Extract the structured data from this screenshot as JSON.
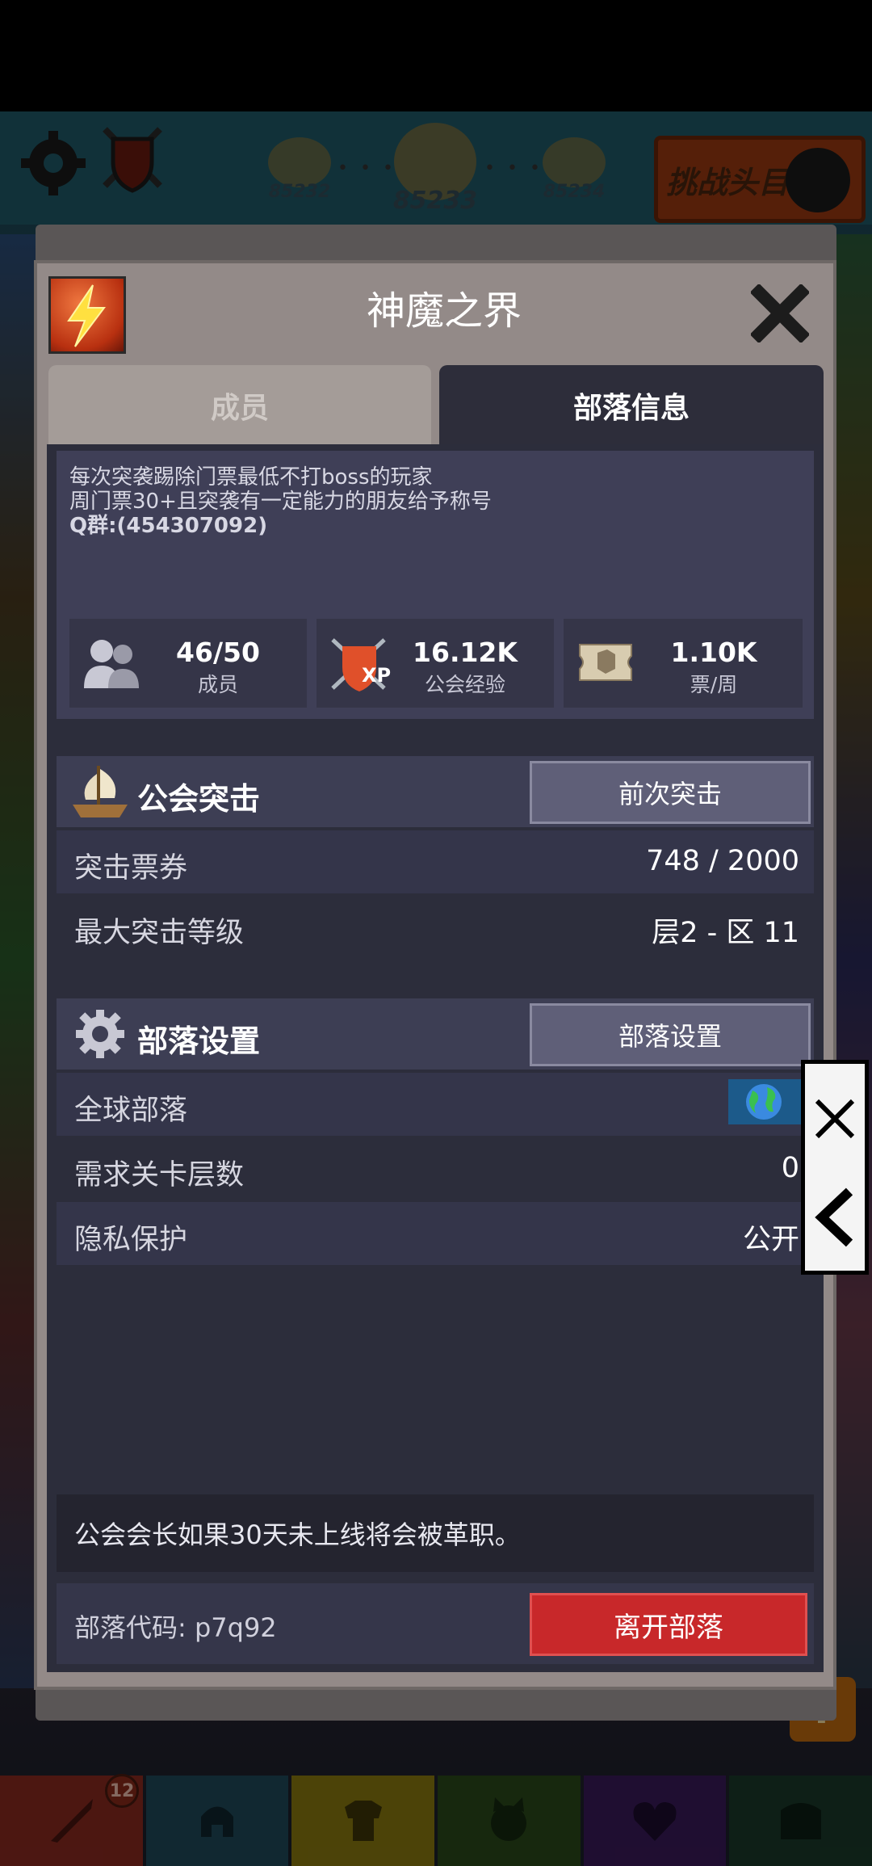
{
  "hud": {
    "stages": [
      "85232",
      "85233",
      "85234"
    ],
    "challenge_button": "挑战头目"
  },
  "dialog": {
    "title": "神魔之界",
    "tabs": {
      "members": "成员",
      "tribe_info": "部落信息"
    },
    "description": [
      "每次突袭踢除门票最低不打boss的玩家",
      "周门票30+且突袭有一定能力的朋友给予称号",
      "Q群:(454307092)"
    ],
    "stats": [
      {
        "value": "46/50",
        "label": "成员",
        "icon": "members-icon"
      },
      {
        "value": "16.12K",
        "label": "公会经验",
        "icon": "xp-shield-icon"
      },
      {
        "value": "1.10K",
        "label": "票/周",
        "icon": "ticket-icon"
      }
    ],
    "raid": {
      "title": "公会突击",
      "button": "前次突击",
      "rows": [
        {
          "label": "突击票券",
          "value": "748 / 2000"
        },
        {
          "label": "最大突击等级",
          "value": "层2 - 区 11"
        }
      ]
    },
    "settings": {
      "title": "部落设置",
      "button": "部落设置",
      "rows": [
        {
          "label": "全球部落",
          "value": "",
          "icon": "globe-icon"
        },
        {
          "label": "需求关卡层数",
          "value": "0"
        },
        {
          "label": "隐私保护",
          "value": "公开"
        }
      ]
    },
    "notice": "公会会长如果30天未上线将会被革职。",
    "tribe_code": "部落代码: p7q92",
    "leave_button": "离开部落"
  },
  "bottom_nav": {
    "badge_count": "12",
    "tabs": [
      "sword-icon",
      "helmet-icon",
      "armor-icon",
      "pet-icon",
      "heart-icon",
      "chest-icon"
    ],
    "colors": [
      "#8a2a20",
      "#1f4a5a",
      "#8a7a10",
      "#2a4a1a",
      "#3a1a5a",
      "#1a3a2a"
    ]
  },
  "help_button": "?",
  "colors": {
    "panel": "#2c2d3b",
    "leave_button": "#c8282a",
    "dialog_frame": "#938a88"
  }
}
